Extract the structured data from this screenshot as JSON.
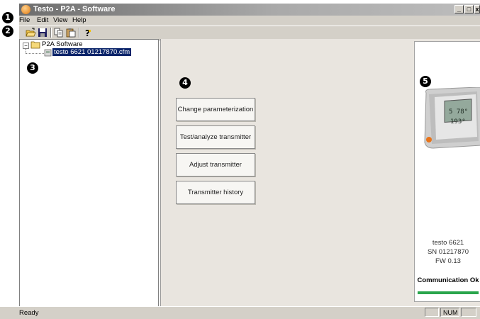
{
  "window": {
    "title": "Testo - P2A - Software",
    "controls": [
      "_",
      "□",
      "x"
    ]
  },
  "callouts": [
    "1",
    "2",
    "3",
    "4",
    "5"
  ],
  "menu": [
    "File",
    "Edit",
    "View",
    "Help"
  ],
  "toolbar": {
    "buttons": [
      "open-icon",
      "save-icon",
      "copy-icon",
      "paste-icon",
      "help-icon"
    ]
  },
  "tree": {
    "root": "P2A Software",
    "child": "testo 6621  01217870.cfm"
  },
  "actions": [
    "Change parameterization",
    "Test/analyze transmitter",
    "Adjust transmitter",
    "Transmitter history"
  ],
  "device": {
    "model": "testo 6621",
    "serial": "SN 01217870",
    "firmware": "FW  0.13",
    "display_line1": "5 78°",
    "display_line2": "193°",
    "status": "Communication Ok",
    "status_color": "#2aa54c"
  },
  "statusbar": {
    "text": "Ready",
    "num": "NUM"
  }
}
